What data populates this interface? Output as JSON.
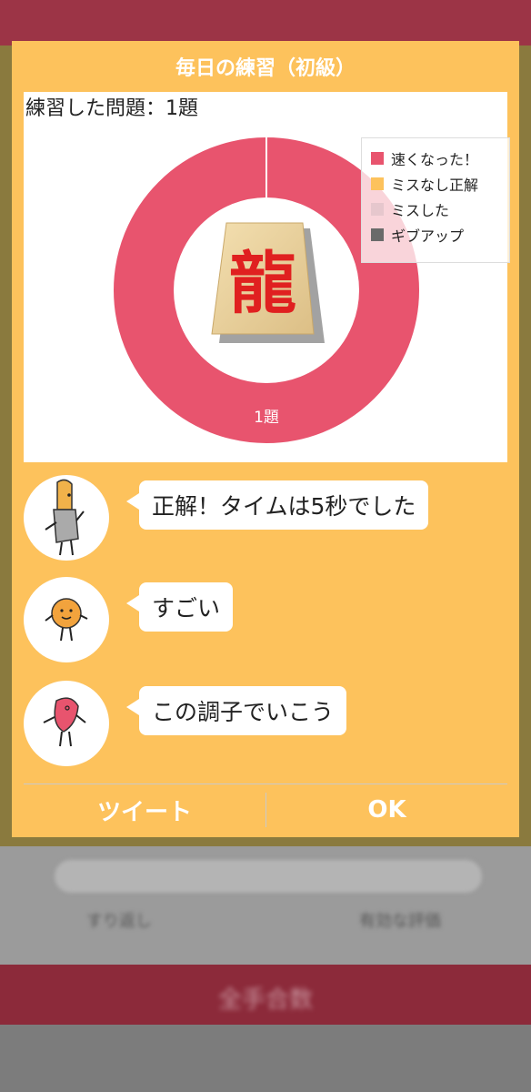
{
  "background": {
    "row_a_left": "すり返し",
    "row_a_right": "有効な評価",
    "bottom_button": "全手合数"
  },
  "dialog": {
    "title": "毎日の練習（初級）",
    "caption": "練習した問題：1題",
    "chart_center_piece": "龍",
    "ok_label": "OK",
    "tweet_label": "ツイート"
  },
  "chart_data": {
    "type": "pie",
    "donut": true,
    "categories": [
      "速くなった！",
      "ミスなし正解",
      "ミスした",
      "ギブアップ"
    ],
    "values": [
      1,
      0,
      0,
      0
    ],
    "colors": [
      "#e8546e",
      "#fdc25c",
      "#e6c7cd",
      "#6a6a6a"
    ],
    "slice_labels": [
      "1題",
      "",
      "",
      ""
    ],
    "legend_placement": "top-right"
  },
  "messages": [
    {
      "avatar": "gold-piece-character",
      "text": "正解！タイムは5秒でした"
    },
    {
      "avatar": "orange-ball-character",
      "text": "すごい"
    },
    {
      "avatar": "pink-drop-character",
      "text": "この調子でいこう"
    }
  ],
  "colors": {
    "dialog_bg": "#fdc25c",
    "accent_red": "#e8546e"
  }
}
